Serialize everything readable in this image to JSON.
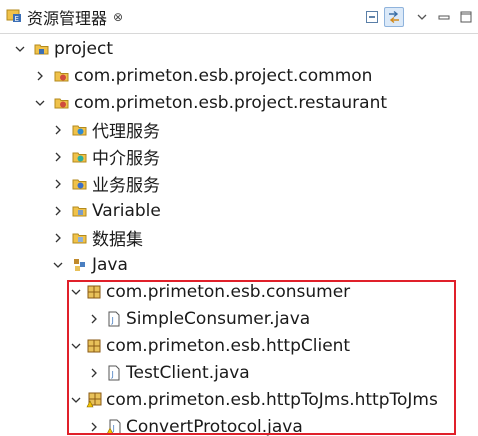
{
  "view": {
    "title": "资源管理器",
    "close_glyph": "⊗",
    "toolbar": [
      "collapse-all-icon",
      "link-with-editor-icon",
      "view-menu-icon",
      "minimize-icon",
      "maximize-icon"
    ]
  },
  "tree": {
    "root": "project",
    "common": "com.primeton.esb.project.common",
    "restaurant": "com.primeton.esb.project.restaurant",
    "proxy_services": "代理服务",
    "mediation_services": "中介服务",
    "business_services": "业务服务",
    "variable": "Variable",
    "datasets": "数据集",
    "java": "Java",
    "pkg_consumer": "com.primeton.esb.consumer",
    "file_simple_consumer": "SimpleConsumer.java",
    "pkg_http_client": "com.primeton.esb.httpClient",
    "file_test_client": "TestClient.java",
    "pkg_http_to_jms": "com.primeton.esb.httpToJms.httpToJms",
    "file_convert_protocol": "ConvertProtocol.java"
  },
  "colors": {
    "highlight": "#e0202a",
    "folder": "#e8c15a",
    "package": "#c08a2c",
    "java_file": "#4a7fc1"
  }
}
